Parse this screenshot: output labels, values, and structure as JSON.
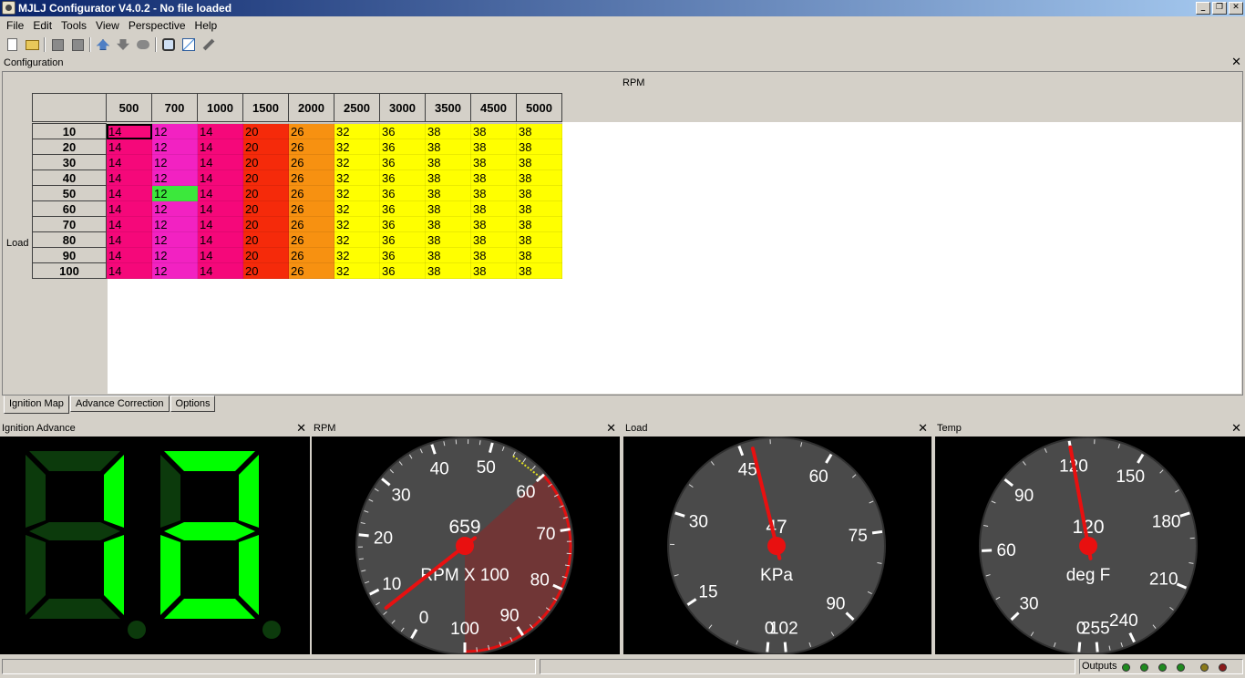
{
  "window": {
    "title": "MJLJ Configurator V4.0.2 - No file loaded",
    "buttons": [
      "_",
      "❐",
      "✕"
    ]
  },
  "menu": [
    "File",
    "Edit",
    "Tools",
    "View",
    "Perspective",
    "Help"
  ],
  "toolbar": [
    "new-icon",
    "open-icon",
    "save-icon",
    "save-as-icon",
    "upload-icon",
    "download-icon",
    "burn-icon",
    "configure-icon",
    "chart-icon",
    "wrench-icon"
  ],
  "config": {
    "title": "Configuration",
    "close": "✕",
    "x_axis_label": "RPM",
    "y_axis_label": "Load",
    "rpm_headers": [
      "500",
      "700",
      "1000",
      "1500",
      "2000",
      "2500",
      "3000",
      "3500",
      "4500",
      "5000"
    ],
    "load_headers": [
      "10",
      "20",
      "30",
      "40",
      "50",
      "60",
      "70",
      "80",
      "90",
      "100"
    ],
    "values": [
      [
        "14",
        "12",
        "14",
        "20",
        "26",
        "32",
        "36",
        "38",
        "38",
        "38"
      ],
      [
        "14",
        "12",
        "14",
        "20",
        "26",
        "32",
        "36",
        "38",
        "38",
        "38"
      ],
      [
        "14",
        "12",
        "14",
        "20",
        "26",
        "32",
        "36",
        "38",
        "38",
        "38"
      ],
      [
        "14",
        "12",
        "14",
        "20",
        "26",
        "32",
        "36",
        "38",
        "38",
        "38"
      ],
      [
        "14",
        "12",
        "14",
        "20",
        "26",
        "32",
        "36",
        "38",
        "38",
        "38"
      ],
      [
        "14",
        "12",
        "14",
        "20",
        "26",
        "32",
        "36",
        "38",
        "38",
        "38"
      ],
      [
        "14",
        "12",
        "14",
        "20",
        "26",
        "32",
        "36",
        "38",
        "38",
        "38"
      ],
      [
        "14",
        "12",
        "14",
        "20",
        "26",
        "32",
        "36",
        "38",
        "38",
        "38"
      ],
      [
        "14",
        "12",
        "14",
        "20",
        "26",
        "32",
        "36",
        "38",
        "38",
        "38"
      ],
      [
        "14",
        "12",
        "14",
        "20",
        "26",
        "32",
        "36",
        "38",
        "38",
        "38"
      ]
    ],
    "column_colors": [
      "#f5087a",
      "#f222c2",
      "#f5087a",
      "#f52a0a",
      "#f79111",
      "#ffff00",
      "#ffff00",
      "#ffff00",
      "#ffff00",
      "#ffff00"
    ],
    "highlight": {
      "row": 4,
      "col": 1,
      "color": "#3ce83c"
    },
    "selected": {
      "row": 0,
      "col": 0
    }
  },
  "tabs": [
    "Ignition Map",
    "Advance Correction",
    "Options"
  ],
  "active_tab": 0,
  "panels": {
    "ignition": {
      "title": "Ignition Advance",
      "close": "✕",
      "display_segment_color": "#00ff00"
    },
    "rpm": {
      "title": "RPM",
      "close": "✕",
      "value": "659",
      "unit": "RPM X 100",
      "ticks": [
        "0",
        "10",
        "20",
        "30",
        "40",
        "50",
        "60",
        "70",
        "80",
        "90",
        "100"
      ],
      "needle_value": 6.59,
      "min": 0,
      "max": 100,
      "redline_start": 60
    },
    "load": {
      "title": "Load",
      "close": "✕",
      "value": "47",
      "unit": "KPa",
      "ticks": [
        "0",
        "15",
        "30",
        "45",
        "60",
        "75",
        "90",
        "102"
      ],
      "needle_value": 47,
      "min": 0,
      "max": 102
    },
    "temp": {
      "title": "Temp",
      "close": "✕",
      "value": "120",
      "unit": "deg F",
      "ticks": [
        "0",
        "30",
        "60",
        "90",
        "120",
        "150",
        "180",
        "210",
        "240",
        "255"
      ],
      "needle_value": 120,
      "min": 0,
      "max": 255
    }
  },
  "status": {
    "outputs_label": "Outputs",
    "leds": [
      "#1f8a1f",
      "#1f8a1f",
      "#1f8a1f",
      "#1f8a1f",
      "#8a7a1a",
      "#8a1a1a"
    ]
  }
}
